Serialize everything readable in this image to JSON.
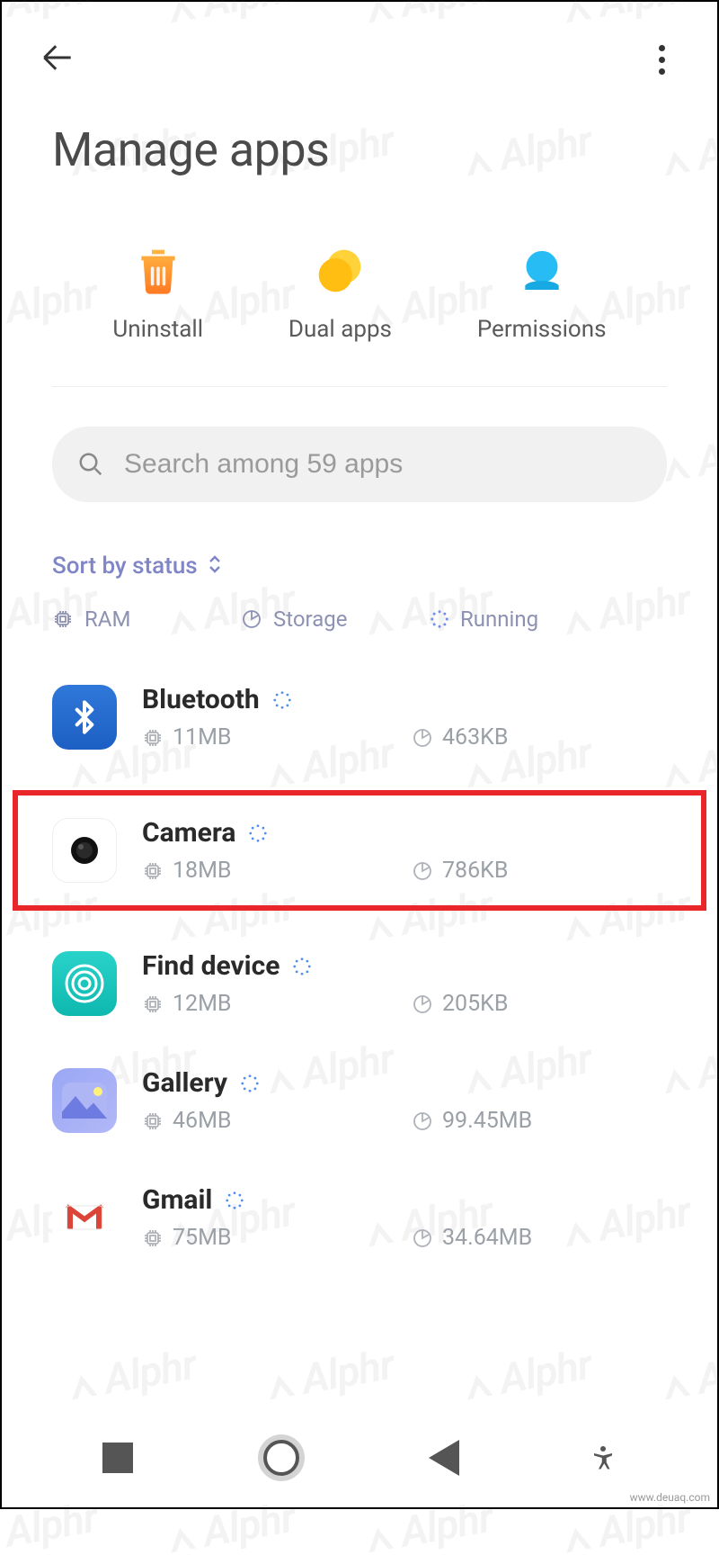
{
  "header": {
    "title": "Manage apps"
  },
  "actions": {
    "uninstall": "Uninstall",
    "dual_apps": "Dual apps",
    "permissions": "Permissions"
  },
  "search": {
    "placeholder": "Search among 59 apps"
  },
  "sort": {
    "label": "Sort by status"
  },
  "legend": {
    "ram": "RAM",
    "storage": "Storage",
    "running": "Running"
  },
  "apps": [
    {
      "name": "Bluetooth",
      "ram": "11MB",
      "storage": "463KB",
      "running": true,
      "highlight": false
    },
    {
      "name": "Camera",
      "ram": "18MB",
      "storage": "786KB",
      "running": true,
      "highlight": true
    },
    {
      "name": "Find device",
      "ram": "12MB",
      "storage": "205KB",
      "running": true,
      "highlight": false
    },
    {
      "name": "Gallery",
      "ram": "46MB",
      "storage": "99.45MB",
      "running": true,
      "highlight": false
    },
    {
      "name": "Gmail",
      "ram": "75MB",
      "storage": "34.64MB",
      "running": true,
      "highlight": false
    }
  ],
  "watermark": "Alphr",
  "footer_url": "www.deuaq.com"
}
